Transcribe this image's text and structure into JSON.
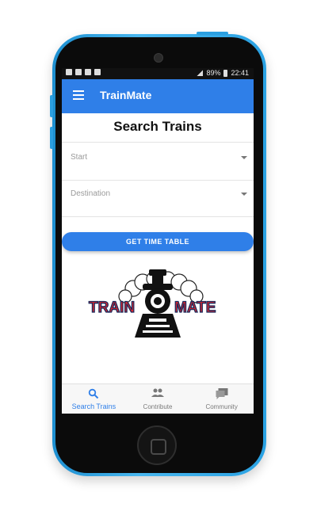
{
  "status_bar": {
    "battery": "89%",
    "time": "22:41"
  },
  "app_bar": {
    "title": "TrainMate",
    "menu_icon": "hamburger-menu-icon"
  },
  "search": {
    "title": "Search Trains",
    "start_label": "Start",
    "destination_label": "Destination",
    "button_label": "GET TIME TABLE"
  },
  "logo": {
    "text_left": "TRAIN",
    "text_right": "MATE"
  },
  "bottom_nav": {
    "items": [
      {
        "label": "Search Trains",
        "icon": "search-icon",
        "active": true
      },
      {
        "label": "Contribute",
        "icon": "people-icon",
        "active": false
      },
      {
        "label": "Community",
        "icon": "forum-icon",
        "active": false
      }
    ]
  },
  "colors": {
    "primary": "#2f7fe8",
    "phone_blue": "#2aa2e3",
    "logo_red": "#d8262f"
  }
}
